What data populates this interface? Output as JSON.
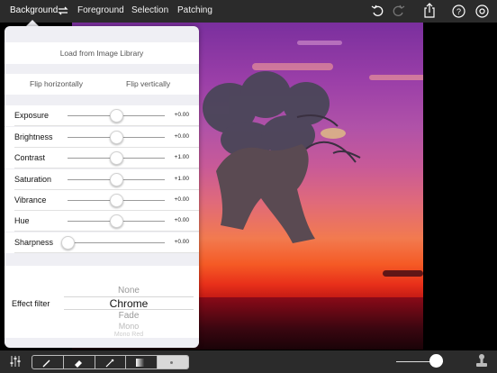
{
  "topbar": {
    "tabs": [
      {
        "label": "Background",
        "active": true
      },
      {
        "label": "Foreground",
        "active": false
      },
      {
        "label": "Selection",
        "active": false
      },
      {
        "label": "Patching",
        "active": false
      }
    ],
    "icons": [
      "swap-icon",
      "undo-icon",
      "redo-icon",
      "share-icon",
      "help-icon",
      "settings-icon"
    ]
  },
  "panel": {
    "load_button": "Load from Image Library",
    "flip_horizontal": "Flip horizontally",
    "flip_vertical": "Flip vertically",
    "sliders": [
      {
        "label": "Exposure",
        "value_text": "+0.00",
        "level": 0.5
      },
      {
        "label": "Brightness",
        "value_text": "+0.00",
        "level": 0.5
      },
      {
        "label": "Contrast",
        "value_text": "+1.00",
        "level": 0.5
      },
      {
        "label": "Saturation",
        "value_text": "+1.00",
        "level": 0.5
      },
      {
        "label": "Vibrance",
        "value_text": "+0.00",
        "level": 0.5
      },
      {
        "label": "Hue",
        "value_text": "+0.00",
        "level": 0.5
      },
      {
        "label": "Sharpness",
        "value_text": "+0.00",
        "level": 0.0
      }
    ],
    "effect_filter": {
      "label": "Effect filter",
      "options": [
        "None",
        "Chrome",
        "Fade",
        "Mono",
        "Mono Red"
      ],
      "selected": "Chrome"
    }
  },
  "bottombar": {
    "tools": [
      "brush-icon",
      "eraser-icon",
      "magic-wand-icon",
      "gradient-icon",
      "dot-icon"
    ],
    "zoom_level": 0.85
  },
  "colors": {
    "bar_bg": "#2b2b2b",
    "panel_bg": "#efeff4"
  }
}
